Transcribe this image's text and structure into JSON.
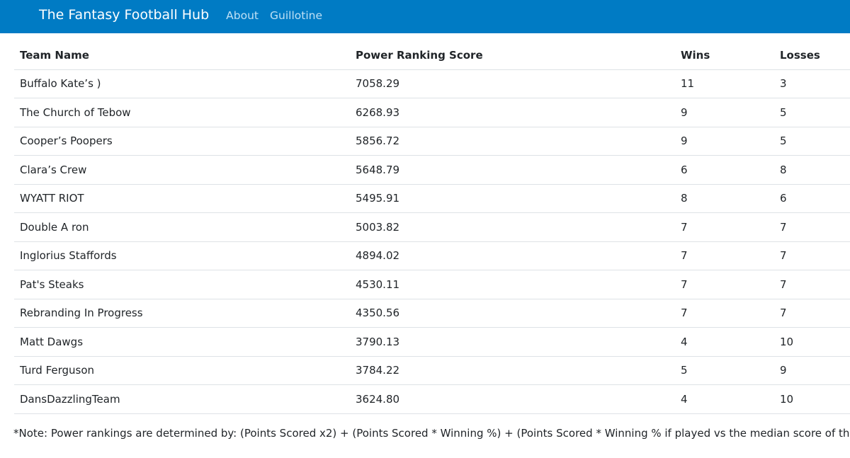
{
  "navbar": {
    "brand": "The Fantasy Football Hub",
    "links": [
      {
        "label": "About"
      },
      {
        "label": "Guillotine"
      }
    ]
  },
  "table": {
    "headers": {
      "team_name": "Team Name",
      "score": "Power Ranking Score",
      "wins": "Wins",
      "losses": "Losses"
    },
    "rows": [
      {
        "team": "Buffalo Kate’s )",
        "score": "7058.29",
        "wins": "11",
        "losses": "3"
      },
      {
        "team": "The Church of Tebow",
        "score": "6268.93",
        "wins": "9",
        "losses": "5"
      },
      {
        "team": "Cooper’s Poopers",
        "score": "5856.72",
        "wins": "9",
        "losses": "5"
      },
      {
        "team": "Clara’s Crew",
        "score": "5648.79",
        "wins": "6",
        "losses": "8"
      },
      {
        "team": "WYATT RIOT",
        "score": "5495.91",
        "wins": "8",
        "losses": "6"
      },
      {
        "team": "Double A ron",
        "score": "5003.82",
        "wins": "7",
        "losses": "7"
      },
      {
        "team": "Inglorius Staffords",
        "score": "4894.02",
        "wins": "7",
        "losses": "7"
      },
      {
        "team": "Pat's Steaks",
        "score": "4530.11",
        "wins": "7",
        "losses": "7"
      },
      {
        "team": "Rebranding In Progress",
        "score": "4350.56",
        "wins": "7",
        "losses": "7"
      },
      {
        "team": "Matt Dawgs",
        "score": "3790.13",
        "wins": "4",
        "losses": "10"
      },
      {
        "team": "Turd Ferguson",
        "score": "3784.22",
        "wins": "5",
        "losses": "9"
      },
      {
        "team": "DansDazzlingTeam",
        "score": "3624.80",
        "wins": "4",
        "losses": "10"
      }
    ]
  },
  "note": "*Note: Power rankings are determined by: (Points Scored x2) + (Points Scored * Winning %) + (Points Scored * Winning % if played vs the median score of the week)",
  "colors": {
    "navbar_bg": "#007bc4",
    "nav_link": "#bfe0f5",
    "row_border": "#dee2e6"
  }
}
